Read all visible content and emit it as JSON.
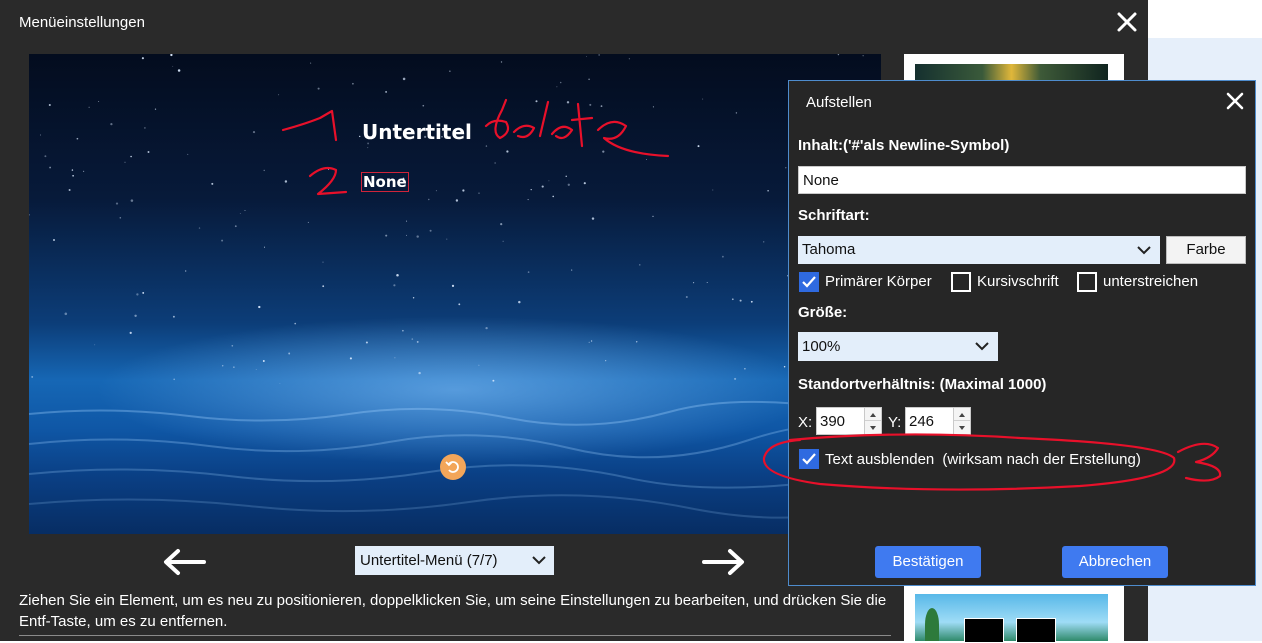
{
  "main_window": {
    "title": "Menüeinstellungen",
    "preview": {
      "subtitle_label": "Untertitel",
      "item_label": "None"
    },
    "nav": {
      "menu_select_value": "Untertitel-Menü (7/7)"
    },
    "help_text": "Ziehen Sie ein Element, um es neu zu positionieren, doppelklicken Sie, um seine Einstellungen zu bearbeiten, und drücken Sie die Entf-Taste, um es zu entfernen."
  },
  "dialog": {
    "title": "Aufstellen",
    "content_label": "Inhalt:('#'als Newline-Symbol)",
    "content_value": "None",
    "font_label": "Schriftart:",
    "font_value": "Tahoma",
    "color_button": "Farbe",
    "checkboxes": [
      {
        "label": "Primärer Körper",
        "checked": true
      },
      {
        "label": "Kursivschrift",
        "checked": false
      },
      {
        "label": "unterstreichen",
        "checked": false
      }
    ],
    "size_label": "Größe:",
    "size_value": "100%",
    "position_label": "Standortverhältnis: (Maximal 1000)",
    "x_label": "X:",
    "x_value": "390",
    "y_label": "Y:",
    "y_value": "246",
    "hide_text": {
      "label": "Text ausblenden",
      "note": "(wirksam nach der Erstellung)",
      "checked": true
    },
    "confirm_button": "Bestätigen",
    "cancel_button": "Abbrechen"
  },
  "annotations": {
    "note_1": "1",
    "note_delete": "delete",
    "note_2": "2",
    "note_3": "3",
    "color": "#e8102a"
  },
  "colors": {
    "window_bg": "#2a2a2a",
    "dialog_bg": "#262626",
    "accent_blue": "#3f7af0",
    "select_bg": "#e3eefa",
    "handle_orange": "#f3a65a"
  }
}
